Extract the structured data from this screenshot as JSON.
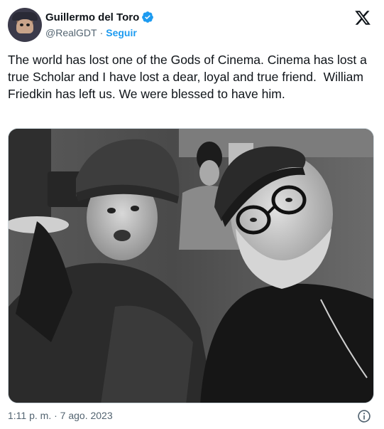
{
  "author": {
    "display_name": "Guillermo del Toro",
    "handle": "@RealGDT",
    "separator": "·",
    "follow_label": "Seguir",
    "verified_icon": "verified-badge-icon",
    "accent": "#1d9bf0"
  },
  "platform_icon": "x-logo-icon",
  "tweet": {
    "text": "The world has lost one of the Gods of Cinema. Cinema has lost a true Scholar and I have lost a dear, loyal and true friend.  William Friedkin has left us. We were blessed to have him."
  },
  "media": {
    "kind": "black-and-white selfie photo"
  },
  "footer": {
    "timestamp": "1:11 p. m. · 7 ago. 2023",
    "info_icon": "info-icon"
  }
}
